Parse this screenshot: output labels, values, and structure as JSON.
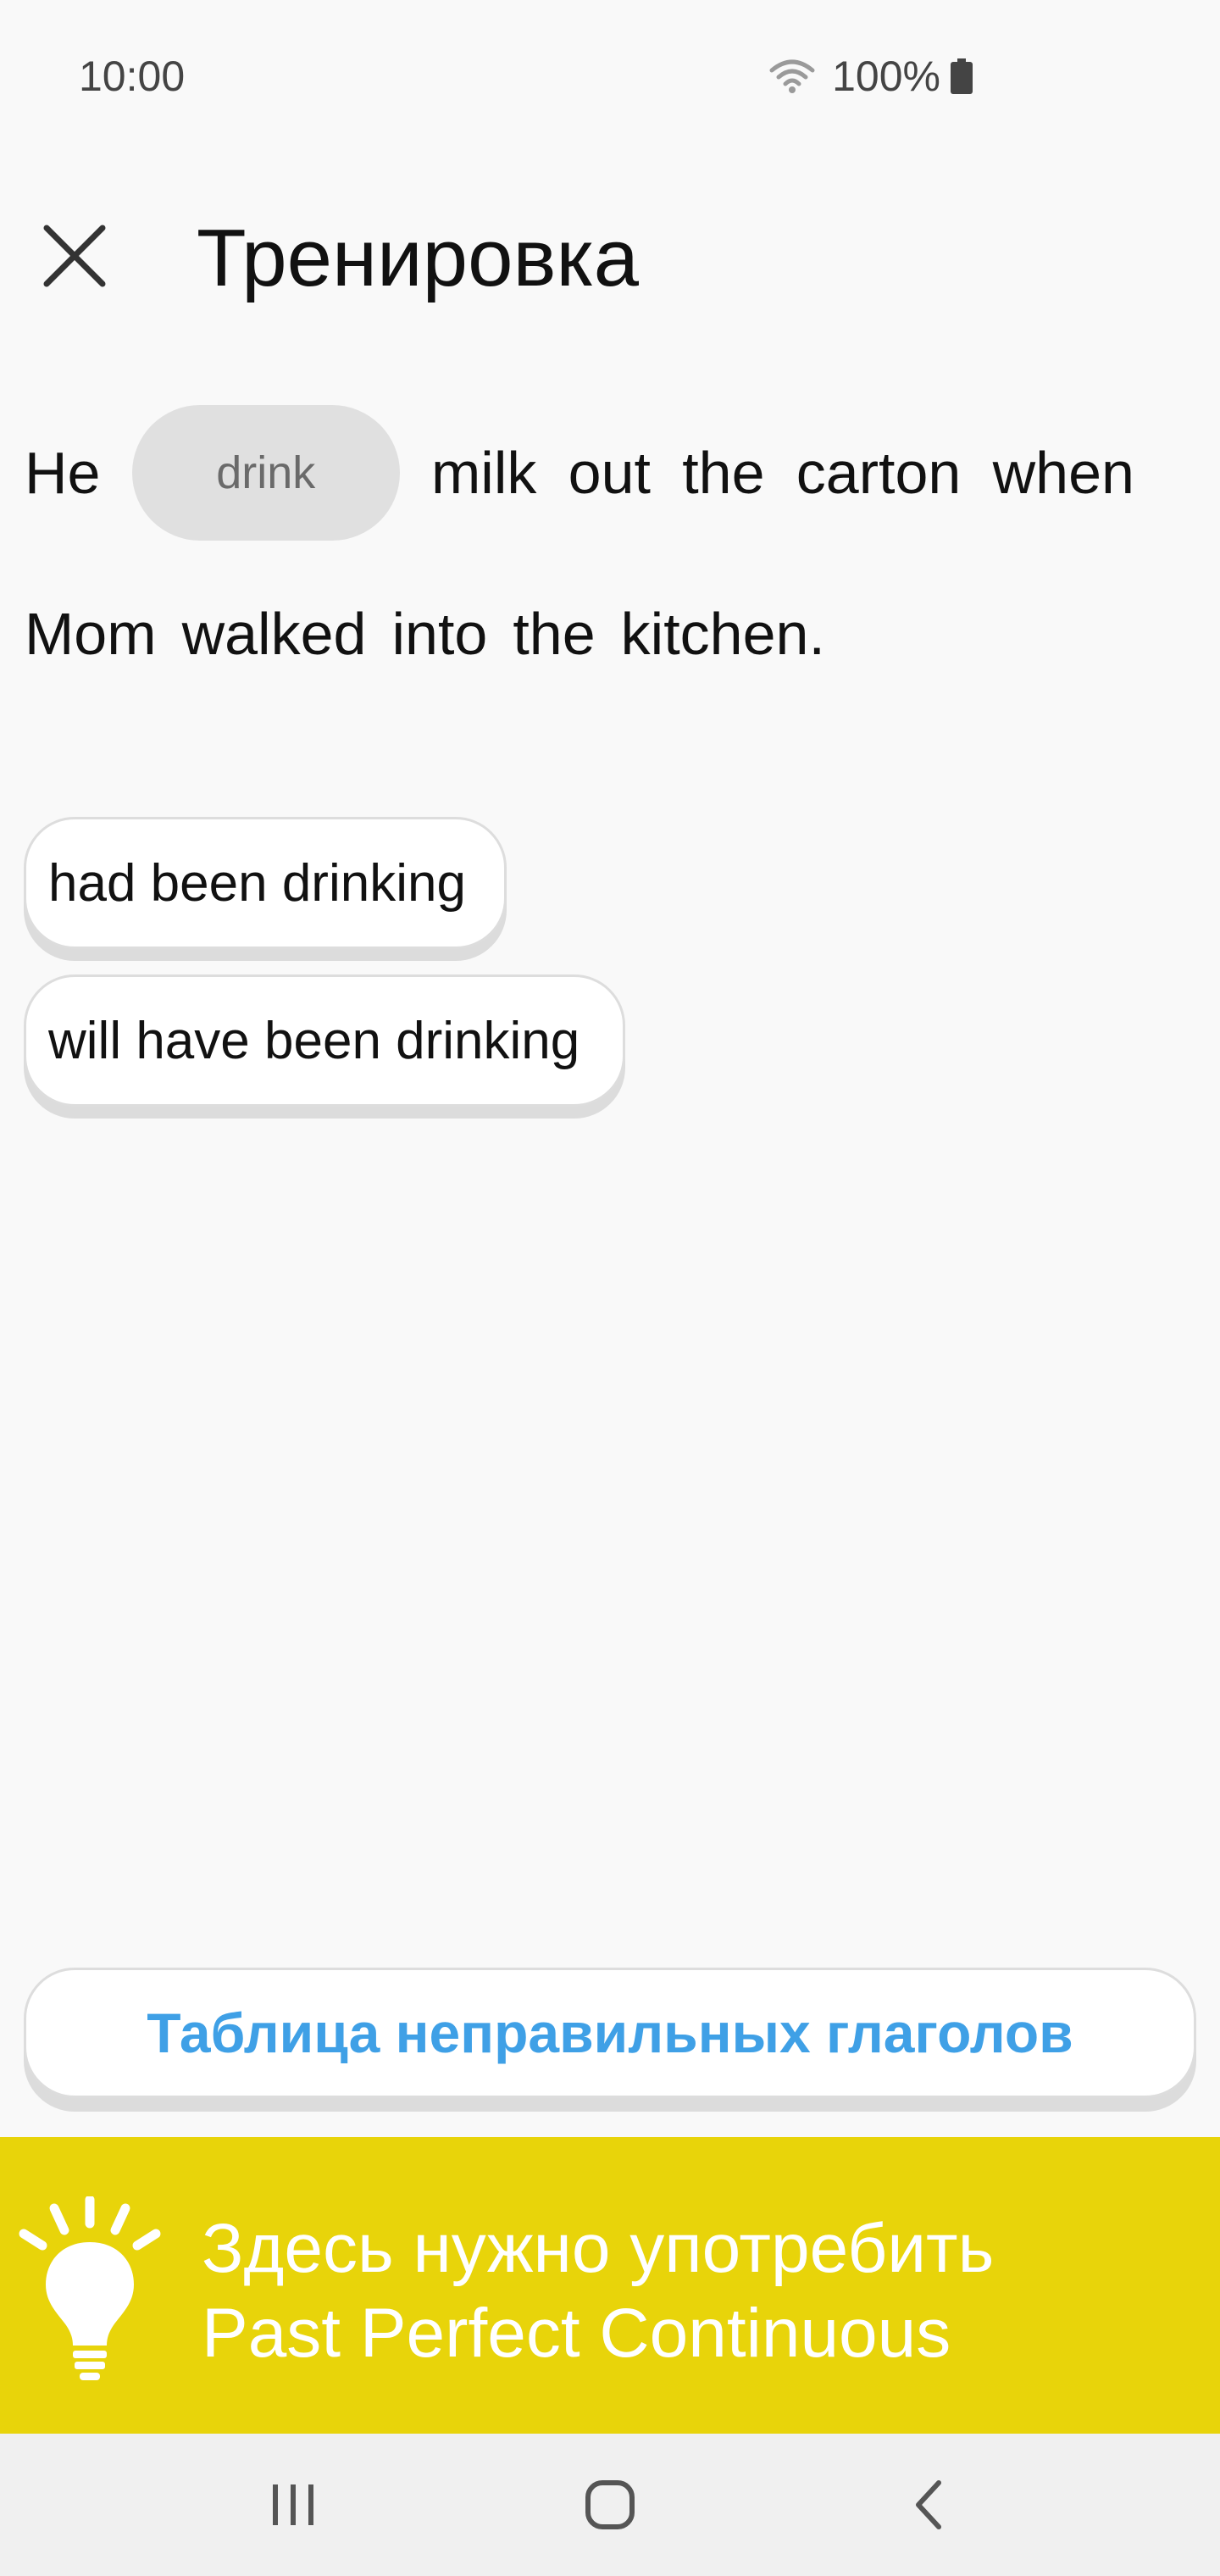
{
  "status_bar": {
    "time": "10:00",
    "battery": "100%"
  },
  "header": {
    "title": "Тренировка",
    "close_icon": "close-icon"
  },
  "exercise": {
    "words_before_gap": [
      "He"
    ],
    "gap_hint": "drink",
    "line1_after_gap": [
      "milk",
      "out",
      "the",
      "carton",
      "when"
    ],
    "line2": [
      "Mom",
      "walked",
      "into",
      "the",
      "kitchen."
    ]
  },
  "options": [
    {
      "label": "had been drinking"
    },
    {
      "label": "will have been drinking"
    }
  ],
  "verbs_table_button": "Таблица неправильных глаголов",
  "hint": {
    "line1": "Здесь нужно употребить",
    "line2": "Past Perfect Continuous",
    "icon": "lightbulb-icon",
    "color": "#e8d40a"
  },
  "colors": {
    "accent": "#3fa0e6",
    "hint_bg": "#e8d40a",
    "background": "#f9f9f9"
  },
  "nav_bar": {
    "recents_icon": "recents-icon",
    "home_icon": "home-icon",
    "back_icon": "back-icon"
  }
}
